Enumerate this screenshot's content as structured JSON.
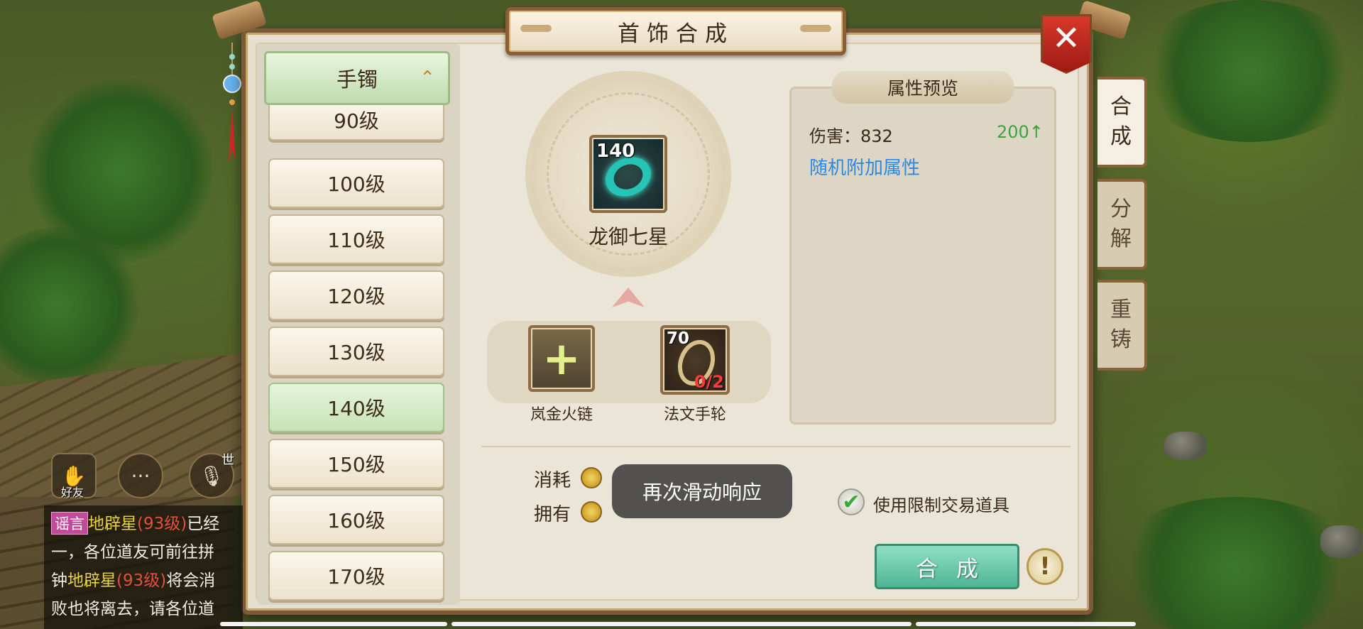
{
  "dialog": {
    "title": "首饰合成",
    "close_symbol": "✕"
  },
  "category": {
    "label": "手镯",
    "chevron": "⌃"
  },
  "levels": [
    "90级",
    "100级",
    "110级",
    "120级",
    "130级",
    "140级",
    "150级",
    "160级",
    "170级"
  ],
  "selected_level": "140级",
  "target": {
    "level": "140",
    "name": "龙御七星"
  },
  "materials": [
    {
      "name": "岚金火链",
      "symbol": "+"
    },
    {
      "name": "法文手轮",
      "level": "70",
      "count": "0/2"
    }
  ],
  "attributes": {
    "title": "属性预览",
    "damage_label": "伤害：832",
    "damage_increase": "200↑",
    "random_label": "随机附加属性"
  },
  "cost": {
    "consume_label": "消耗",
    "own_label": "拥有"
  },
  "options": {
    "restricted_items_label": "使用限制交易道具",
    "restricted_items_checked": true,
    "check_symbol": "✔"
  },
  "actions": {
    "craft_label": "合成",
    "info_symbol": "!"
  },
  "side_tabs": [
    {
      "label_top": "合",
      "label_bottom": "成",
      "active": true
    },
    {
      "label_top": "分",
      "label_bottom": "解",
      "active": false
    },
    {
      "label_top": "重",
      "label_bottom": "铸",
      "active": false
    }
  ],
  "toast": "再次滑动响应",
  "hud": {
    "friends_label": "好友",
    "world_label": "世",
    "chat_icon": "···",
    "mic_icon": "🎙"
  },
  "chat": {
    "tag": "谣言",
    "line1_name": "地辟星",
    "line1_level": "(93级)",
    "line1_rest": "已经",
    "line2": "一，各位道友可前往拼",
    "line3_prefix": "钟",
    "line3_name": "地辟星",
    "line3_level": "(93级)",
    "line3_rest": "将会消",
    "line4": "败也将离去，请各位道"
  },
  "colors": {
    "green_increase": "#3aa63a",
    "blue_link": "#2b8ae0",
    "error_red": "#ff3a3a"
  }
}
